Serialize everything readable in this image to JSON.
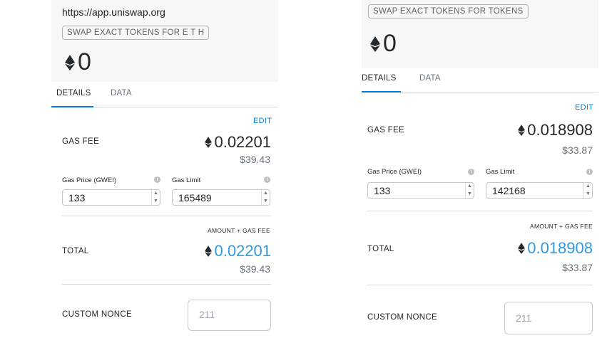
{
  "left": {
    "origin": "https://app.uniswap.org",
    "method": "SWAP EXACT TOKENS FOR E T H",
    "amount": "0",
    "tabs": [
      "DETAILS",
      "DATA"
    ],
    "edit": "EDIT",
    "gas_fee_label": "GAS FEE",
    "gas_fee_eth": "0.02201",
    "gas_fee_usd": "$39.43",
    "gas_price_label": "Gas Price (GWEI)",
    "gas_limit_label": "Gas Limit",
    "gas_price": "133",
    "gas_limit": "165489",
    "amount_gas_fee_label": "AMOUNT + GAS FEE",
    "total_label": "TOTAL",
    "total_eth": "0.02201",
    "total_usd": "$39.43",
    "custom_nonce_label": "CUSTOM NONCE",
    "nonce_placeholder": "211"
  },
  "right": {
    "method": "SWAP EXACT TOKENS FOR TOKENS",
    "amount": "0",
    "tabs": [
      "DETAILS",
      "DATA"
    ],
    "edit": "EDIT",
    "gas_fee_label": "GAS FEE",
    "gas_fee_eth": "0.018908",
    "gas_fee_usd": "$33.87",
    "gas_price_label": "Gas Price (GWEI)",
    "gas_limit_label": "Gas Limit",
    "gas_price": "133",
    "gas_limit": "142168",
    "amount_gas_fee_label": "AMOUNT + GAS FEE",
    "total_label": "TOTAL",
    "total_eth": "0.018908",
    "total_usd": "$33.87",
    "custom_nonce_label": "CUSTOM NONCE",
    "nonce_placeholder": "211"
  },
  "icons": {
    "eth": "ethereum-diamond-icon",
    "info": "info-icon",
    "stepper": "stepper-arrows-icon"
  },
  "colors": {
    "accent": "#037dd6",
    "total_blue": "#2f9ae0",
    "header_bg": "#f7f7f7",
    "muted": "#6a737d"
  }
}
